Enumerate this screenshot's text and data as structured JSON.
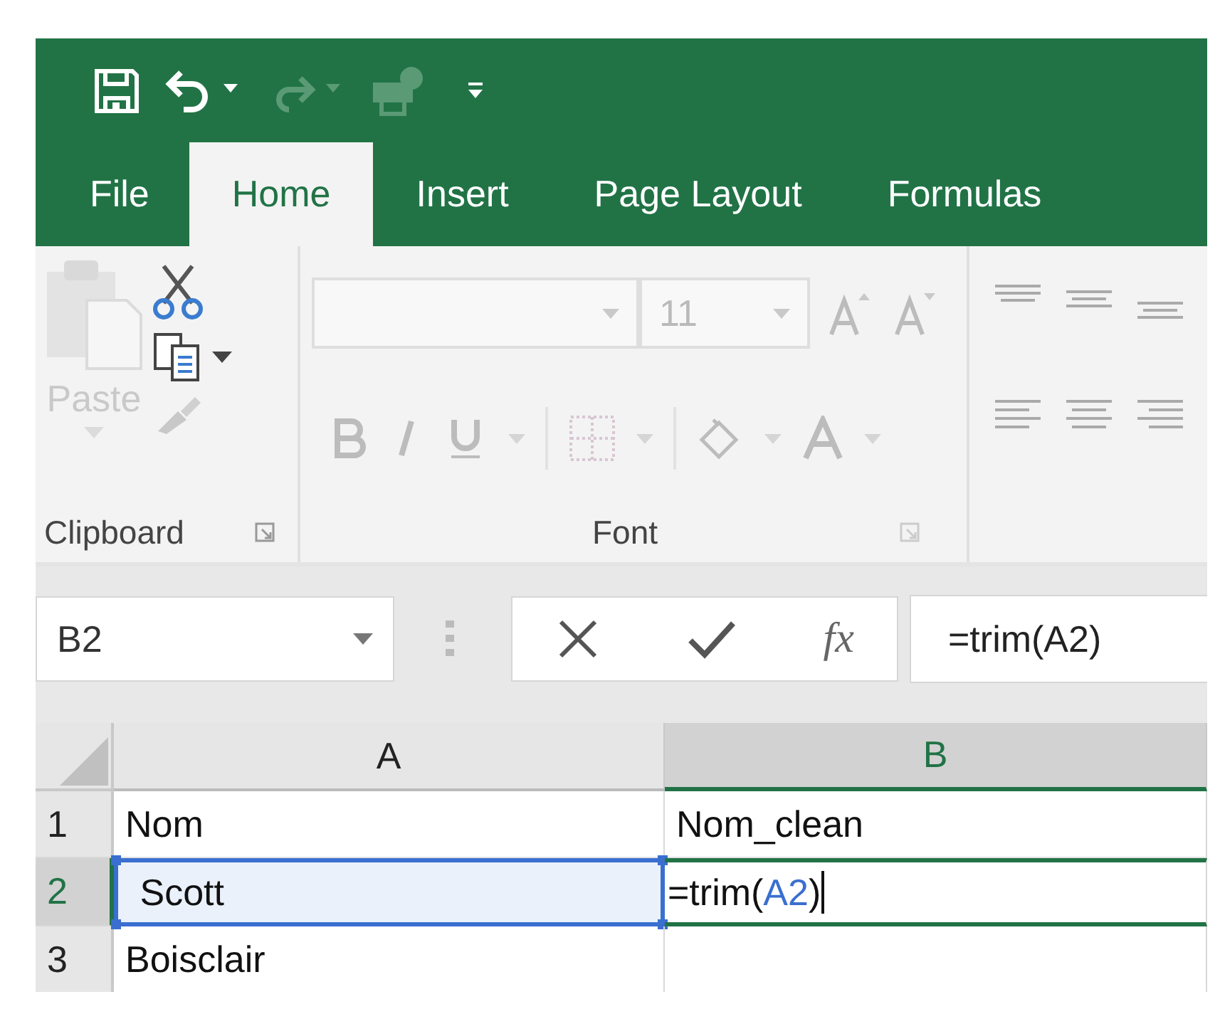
{
  "quick_access": [
    {
      "kind": "save",
      "disabled": false
    },
    {
      "kind": "undo",
      "disabled": false
    },
    {
      "kind": "redo",
      "disabled": true
    },
    {
      "kind": "touch",
      "disabled": true
    },
    {
      "kind": "customize",
      "disabled": false
    }
  ],
  "tabs": [
    {
      "label": "File",
      "selected": false
    },
    {
      "label": "Home",
      "selected": true
    },
    {
      "label": "Insert",
      "selected": false
    },
    {
      "label": "Page Layout",
      "selected": false
    },
    {
      "label": "Formulas",
      "selected": false
    }
  ],
  "ribbon": {
    "clipboard": {
      "paste_label": "Paste",
      "group_label": "Clipboard",
      "disabled": true
    },
    "font": {
      "font_size": "11",
      "group_label": "Font",
      "disabled": true
    }
  },
  "formula_bar": {
    "name_box": "B2",
    "fx_label": "fx",
    "formula": "=trim(A2)"
  },
  "columns": [
    {
      "label": "A",
      "selected": false
    },
    {
      "label": "B",
      "selected": true
    }
  ],
  "rows": [
    {
      "number": "1",
      "selected": false,
      "cells": [
        {
          "text": "Nom",
          "referenced": false,
          "editing": false
        },
        {
          "text": "Nom_clean",
          "referenced": false,
          "editing": false
        }
      ]
    },
    {
      "number": "2",
      "selected": true,
      "cells": [
        {
          "text": " Scott",
          "referenced": true,
          "editing": false
        },
        {
          "parts": [
            {
              "text": "=trim(",
              "ref": false
            },
            {
              "text": "A2",
              "ref": true
            },
            {
              "text": ")",
              "ref": false
            }
          ],
          "referenced": false,
          "editing": true
        }
      ]
    },
    {
      "number": "3",
      "selected": false,
      "cells": [
        {
          "text": "Boisclair",
          "referenced": false,
          "editing": false
        },
        {
          "text": "",
          "referenced": false,
          "editing": false
        }
      ]
    }
  ]
}
